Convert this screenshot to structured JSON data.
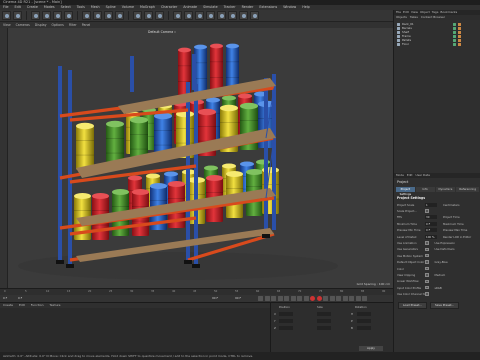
{
  "window": {
    "title": "Cinema 4D R21 - [scene * - Main]"
  },
  "menubar": [
    "File",
    "Edit",
    "Create",
    "Modes",
    "Select",
    "Tools",
    "Mesh",
    "Spline",
    "Volume",
    "MoGraph",
    "Character",
    "Animate",
    "Simulate",
    "Tracker",
    "Render",
    "Extensions",
    "Window",
    "Help"
  ],
  "viewport": {
    "menu": [
      "View",
      "Cameras",
      "Display",
      "Options",
      "Filter",
      "Panel"
    ],
    "camera_label": "Default Camera :: ",
    "grid_spacing": "Grid Spacing : 100 cm"
  },
  "object_manager": {
    "tabs": [
      "File",
      "Edit",
      "View",
      "Object",
      "Tags",
      "Bookmarks"
    ],
    "menu": [
      "Objects",
      "Takes",
      "Content Browser"
    ],
    "objects": [
      {
        "name": "Rack_01",
        "icon": "null-icon"
      },
      {
        "name": "Barrels",
        "icon": "null-icon"
      },
      {
        "name": "Shelf",
        "icon": "polygon-icon"
      },
      {
        "name": "Frame",
        "icon": "polygon-icon"
      },
      {
        "name": "Pallets",
        "icon": "polygon-icon"
      },
      {
        "name": "Floor",
        "icon": "polygon-icon"
      }
    ]
  },
  "attribute_manager": {
    "header": [
      "Mode",
      "Edit",
      "User Data"
    ],
    "title": "Project",
    "tabs": [
      "Project Settings",
      "Info",
      "Dynamics",
      "Referencing"
    ],
    "active_tab": 0,
    "section": "Project Settings",
    "rows": [
      {
        "label": "Project Scale",
        "value": "1",
        "right": "Centimeters"
      },
      {
        "label": "Scale Project...",
        "value": "",
        "right": ""
      },
      {
        "label": "FPS",
        "value": "30",
        "right": "Project Time"
      },
      {
        "label": "Minimum Time",
        "value": "0 F",
        "right": "Maximum Time"
      },
      {
        "label": "Preview Min Time",
        "value": "0 F",
        "right": "Preview Max Time"
      },
      {
        "label": "Level of Detail",
        "value": "100 %",
        "right": "Render LOD in Editor"
      },
      {
        "label": "Use Animation",
        "value": "",
        "right": "Use Expression"
      },
      {
        "label": "Use Generators",
        "value": "",
        "right": "Use Deformers"
      },
      {
        "label": "Use Motion System",
        "value": "",
        "right": ""
      },
      {
        "label": "Default Object Color",
        "value": "",
        "right": "Gray-Blue"
      },
      {
        "label": "Color",
        "value": "",
        "right": ""
      },
      {
        "label": "View Clipping",
        "value": "",
        "right": "Medium"
      },
      {
        "label": "Linear Workflow",
        "value": "",
        "right": ""
      },
      {
        "label": "Input Color Profile",
        "value": "",
        "right": "sRGB"
      },
      {
        "label": "Use Color Channel for Node Material",
        "value": "",
        "right": ""
      }
    ],
    "buttons": [
      "Load Preset...",
      "Save Preset..."
    ]
  },
  "timeline": {
    "ticks": [
      "0",
      "5",
      "10",
      "15",
      "20",
      "25",
      "30",
      "35",
      "40",
      "45",
      "50",
      "55",
      "60",
      "65",
      "70",
      "75",
      "80",
      "85",
      "90"
    ],
    "start_frame": "0 F",
    "current_frame": "0 F",
    "end_frame": "90 F",
    "end_frame2": "90 F"
  },
  "material_manager": {
    "menu": [
      "Create",
      "Edit",
      "Function",
      "Texture"
    ]
  },
  "coordinates": {
    "labels": [
      "Position",
      "Size",
      "Rotation",
      "X",
      "Y",
      "Z",
      "H",
      "P",
      "B"
    ],
    "apply": "Apply"
  },
  "status": "Azimuth: 0.0°, Altitude: 0.0° N   Move: Click and drag to move elements. Hold down SHIFT to quantize movement / add to the selection in point mode, CTRL to remove.",
  "colors": {
    "accent": "#4a6a8a",
    "rack_frame": "#2a4fa8",
    "rack_beam": "#d84a1c",
    "barrel_red": "#d8232a",
    "barrel_blue": "#2a6ad0",
    "barrel_yellow": "#e8d020",
    "barrel_green": "#4a9a30",
    "pallet": "#9a7a55"
  }
}
